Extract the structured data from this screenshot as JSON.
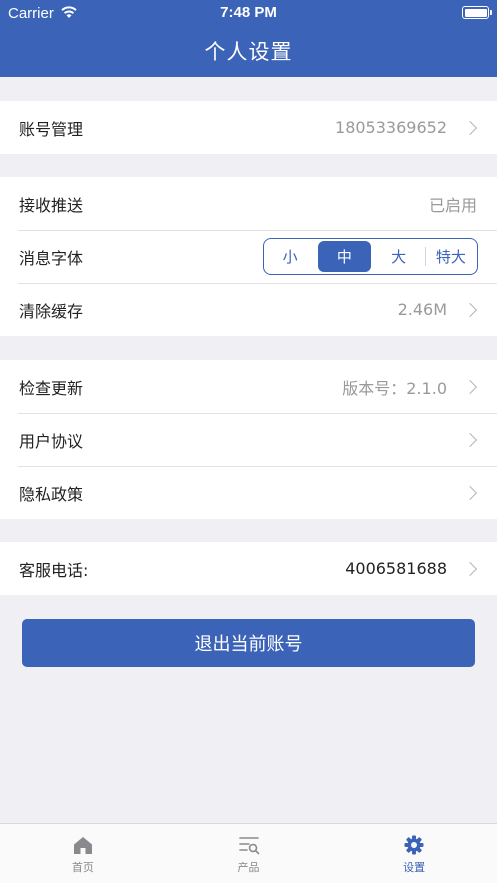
{
  "status_bar": {
    "carrier": "Carrier",
    "time": "7:48 PM"
  },
  "nav": {
    "title": "个人设置"
  },
  "account": {
    "label": "账号管理",
    "value": "18053369652"
  },
  "push": {
    "label": "接收推送",
    "value": "已启用"
  },
  "font": {
    "label": "消息字体",
    "options": [
      "小",
      "中",
      "大",
      "特大"
    ],
    "selected": "中"
  },
  "cache": {
    "label": "清除缓存",
    "value": "2.46M"
  },
  "update": {
    "label": "检查更新",
    "value": "版本号：2.1.0"
  },
  "agreement": {
    "label": "用户协议"
  },
  "privacy": {
    "label": "隐私政策"
  },
  "service": {
    "label": "客服电话:",
    "value": "4006581688"
  },
  "logout": {
    "label": "退出当前账号"
  },
  "tabs": [
    {
      "label": "首页",
      "icon": "home-icon"
    },
    {
      "label": "产品",
      "icon": "product-list-icon"
    },
    {
      "label": "设置",
      "icon": "gear-icon"
    }
  ],
  "colors": {
    "primary": "#3b63b8",
    "background": "#efeff4"
  }
}
